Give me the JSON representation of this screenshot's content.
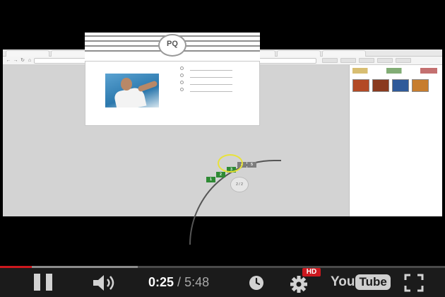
{
  "browser": {
    "tabs": [
      "",
      "",
      "",
      "",
      "",
      "",
      "",
      ""
    ],
    "url": ""
  },
  "quiz": {
    "logo": "PQ",
    "question": "",
    "options": [
      "",
      "",
      "",
      ""
    ],
    "answer_label": "",
    "caption": "",
    "below_card": "",
    "score": "2 / 2",
    "steps": [
      "1",
      "2",
      "3",
      "4",
      "5"
    ]
  },
  "overlay": {
    "watermark": ""
  },
  "player": {
    "current_time": "0:25",
    "separator": "/",
    "duration": "5:48",
    "progress_played_fraction": 0.072,
    "progress_buffered_fraction": 0.31,
    "hd_label": "HD",
    "logo_you": "You",
    "logo_tube": "Tube",
    "icons": {
      "pause": "pause-icon",
      "volume": "volume-icon",
      "watch_later": "clock-icon",
      "settings": "gear-icon",
      "fullscreen": "fullscreen-icon"
    },
    "colors": {
      "progress_played": "#cc181e",
      "hd_badge": "#cc181e",
      "step_green": "#2e8a34"
    }
  }
}
